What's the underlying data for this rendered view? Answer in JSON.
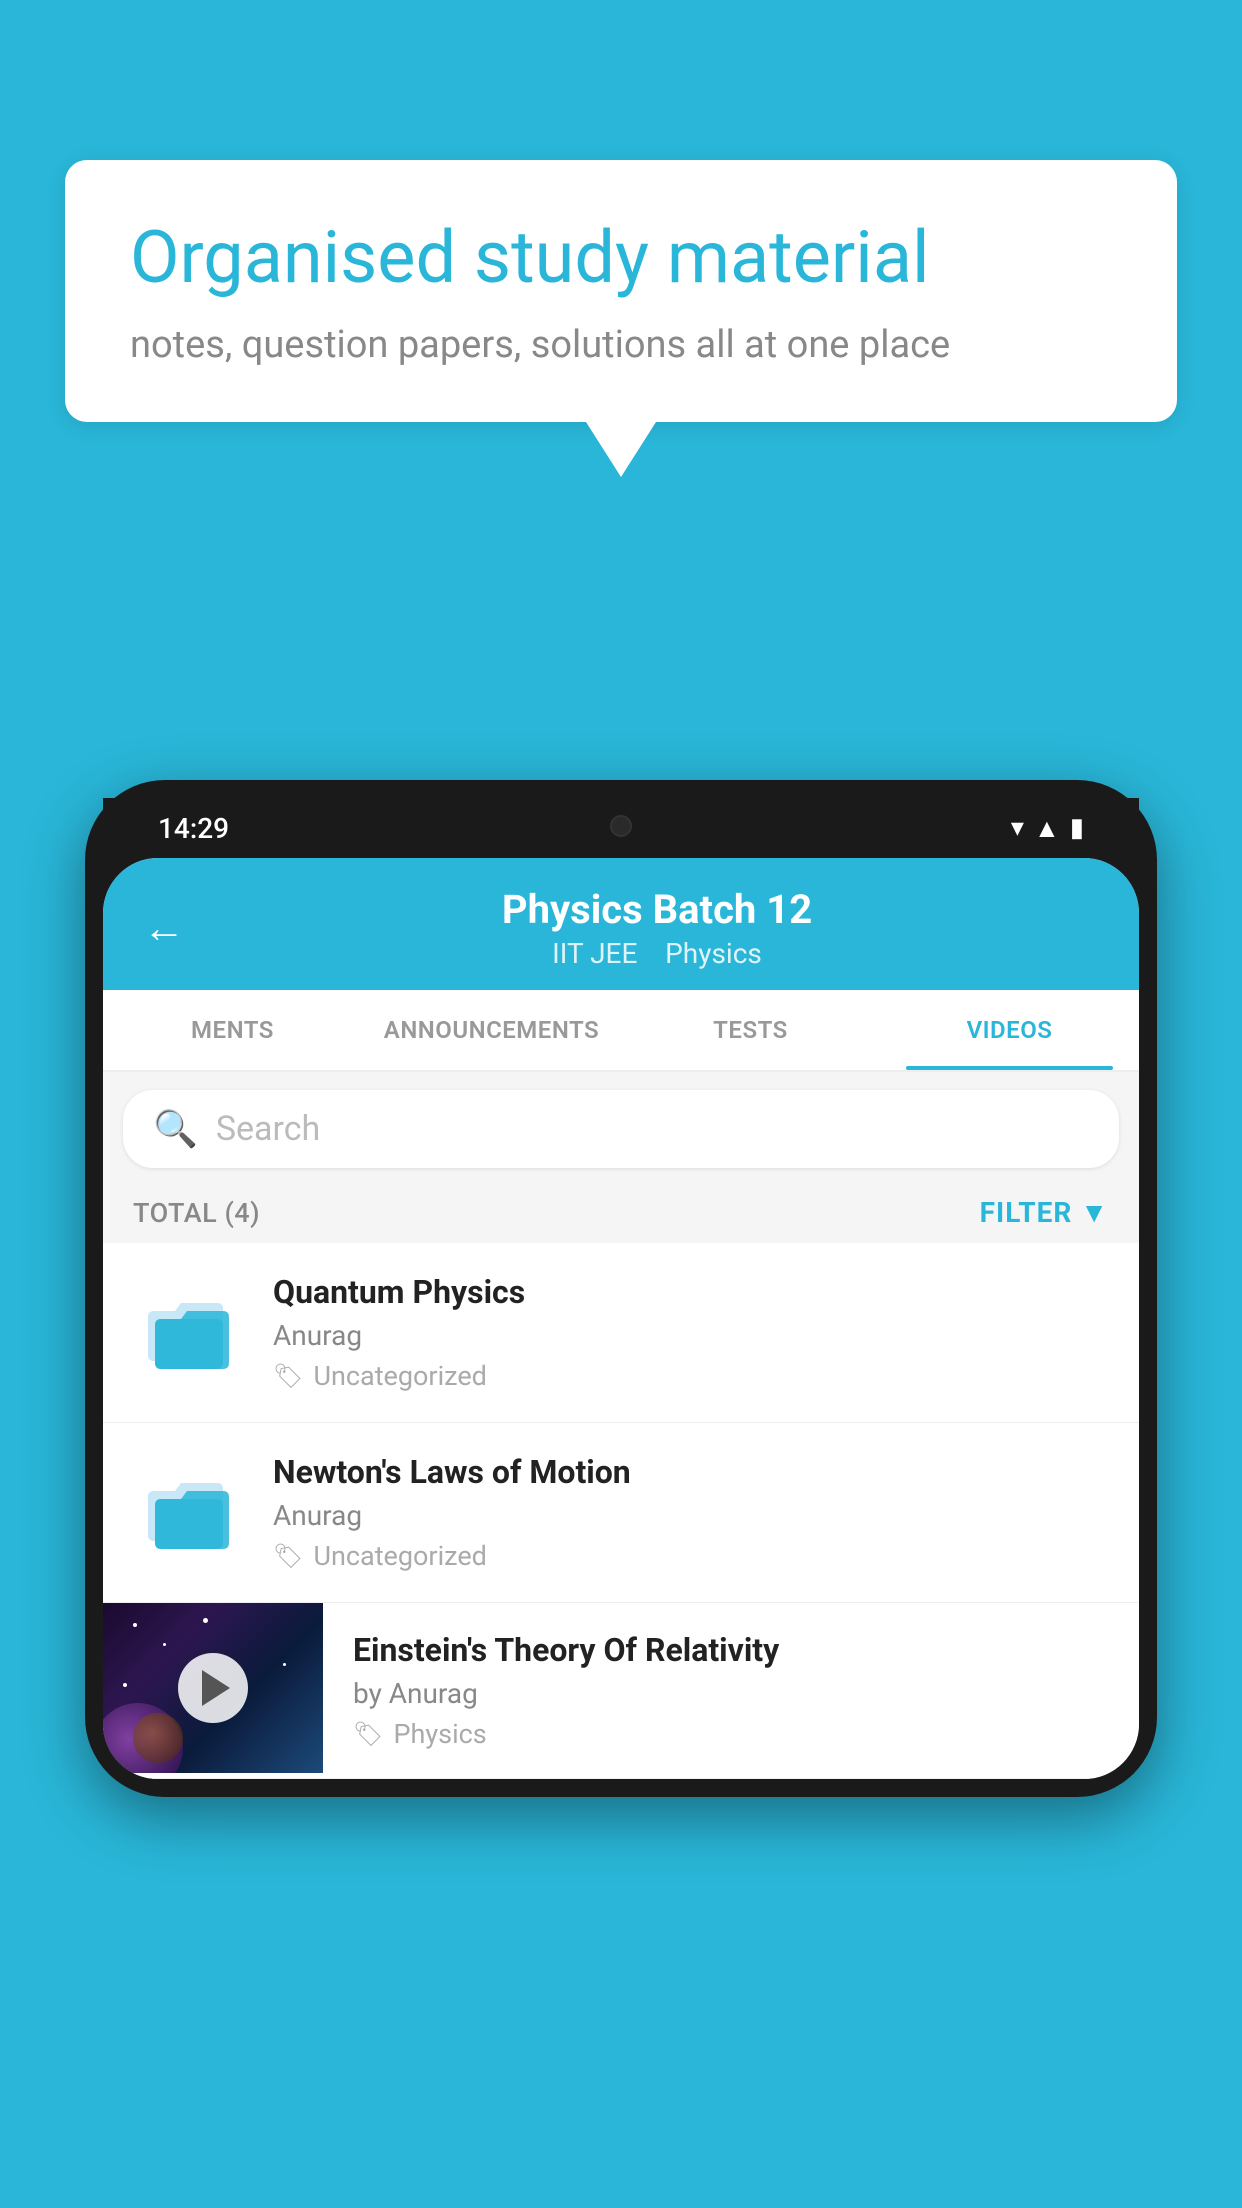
{
  "background_color": "#29b6d8",
  "speech_bubble": {
    "title": "Organised study material",
    "subtitle": "notes, question papers, solutions all at one place"
  },
  "phone": {
    "status_bar": {
      "time": "14:29",
      "wifi": "▼",
      "signal": "◀",
      "battery": "▮"
    },
    "header": {
      "back_label": "←",
      "title": "Physics Batch 12",
      "subtitle_tag1": "IIT JEE",
      "subtitle_tag2": "Physics"
    },
    "tabs": [
      {
        "label": "MENTS",
        "active": false
      },
      {
        "label": "ANNOUNCEMENTS",
        "active": false
      },
      {
        "label": "TESTS",
        "active": false
      },
      {
        "label": "VIDEOS",
        "active": true
      }
    ],
    "search": {
      "placeholder": "Search"
    },
    "filter_bar": {
      "total_label": "TOTAL (4)",
      "filter_label": "FILTER"
    },
    "videos": [
      {
        "id": 1,
        "title": "Quantum Physics",
        "author": "Anurag",
        "tag": "Uncategorized",
        "has_thumbnail": false
      },
      {
        "id": 2,
        "title": "Newton's Laws of Motion",
        "author": "Anurag",
        "tag": "Uncategorized",
        "has_thumbnail": false
      },
      {
        "id": 3,
        "title": "Einstein's Theory Of Relativity",
        "author": "by Anurag",
        "tag": "Physics",
        "has_thumbnail": true
      }
    ]
  }
}
